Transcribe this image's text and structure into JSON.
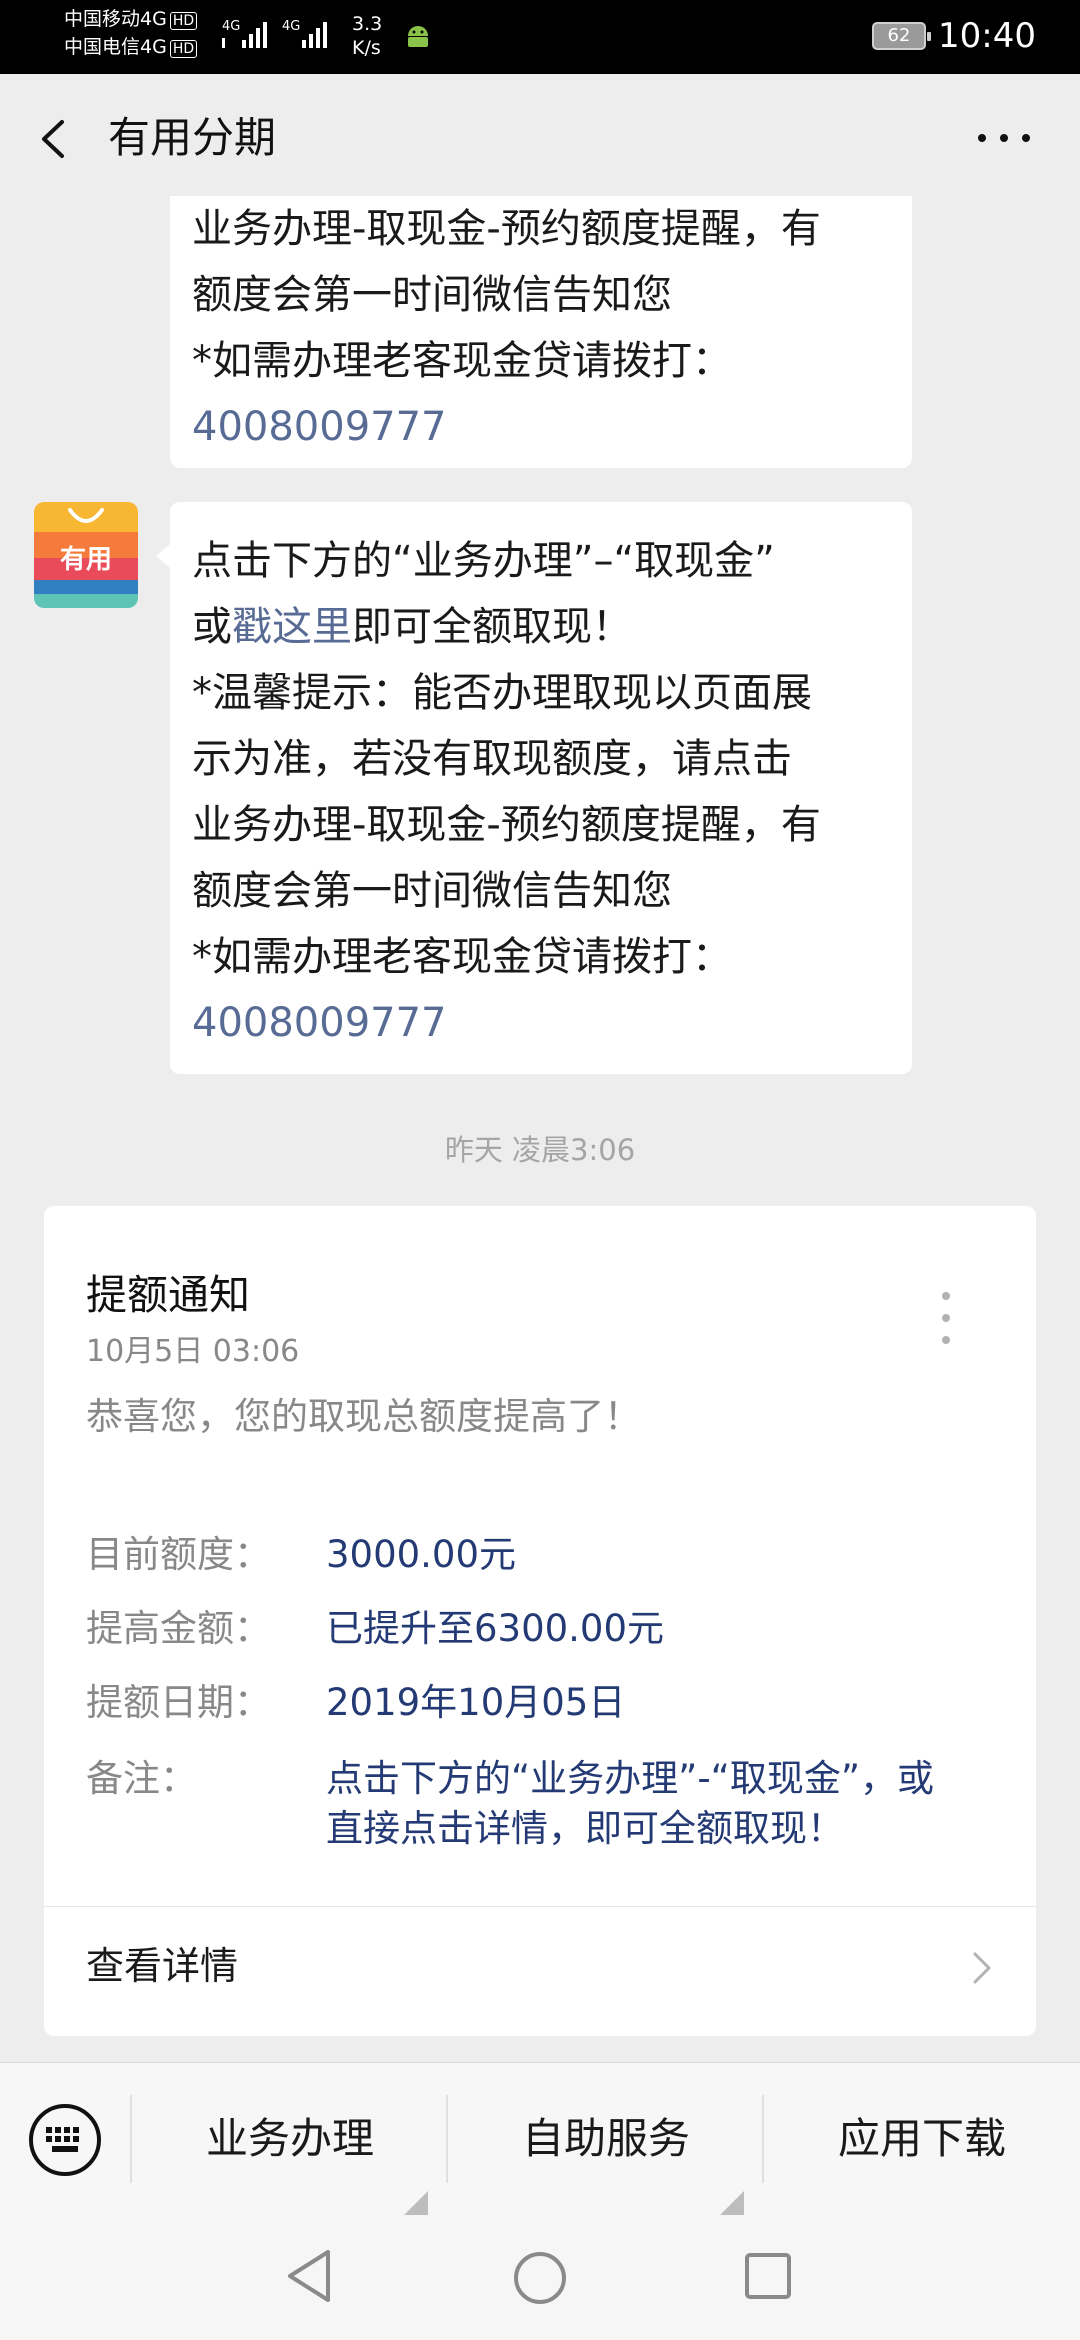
{
  "status_bar": {
    "carrier1": "中国移动4G",
    "carrier2": "中国电信4G",
    "hd": "HD",
    "net1": "4G",
    "net2": "4G",
    "speed_value": "3.3",
    "speed_unit": "K/s",
    "battery": "62",
    "time": "10:40"
  },
  "header": {
    "title": "有用分期"
  },
  "messages": {
    "bubble1": {
      "line1": "业务办理-取现金-预约额度提醒，有",
      "line2": "额度会第一时间微信告知您",
      "line3": "*如需办理老客现金贷请拨打：",
      "phone": "4008009777"
    },
    "bubble2": {
      "line1": "点击下方的“业务办理”–“取现金”",
      "line2_prefix": "或",
      "line2_link": "戳这里",
      "line2_suffix": "即可全额取现！",
      "line3": "*温馨提示：能否办理取现以页面展",
      "line4": "示为准，若没有取现额度，请点击",
      "line5": "业务办理-取现金-预约额度提醒，有",
      "line6": "额度会第一时间微信告知您",
      "line7": "*如需办理老客现金贷请拨打：",
      "phone": "4008009777"
    },
    "avatar_text": "有用",
    "timestamp": "昨天 凌晨3:06"
  },
  "card": {
    "title": "提额通知",
    "date": "10月5日  03:06",
    "message": "恭喜您，您的取现总额度提高了！",
    "rows": [
      {
        "label": "目前额度：",
        "value": "3000.00元"
      },
      {
        "label": "提高金额：",
        "value": "已提升至6300.00元"
      },
      {
        "label": "提额日期：",
        "value": "2019年10月05日"
      },
      {
        "label": "备注：",
        "value": "点击下方的“业务办理”-“取现金”，或",
        "value2": "直接点击详情，即可全额取现！"
      }
    ],
    "link": "查看详情"
  },
  "menu": {
    "items": [
      "业务办理",
      "自助服务",
      "应用下载"
    ]
  },
  "colors": {
    "link": "#576b95",
    "value": "#243a74",
    "background": "#ededed"
  }
}
